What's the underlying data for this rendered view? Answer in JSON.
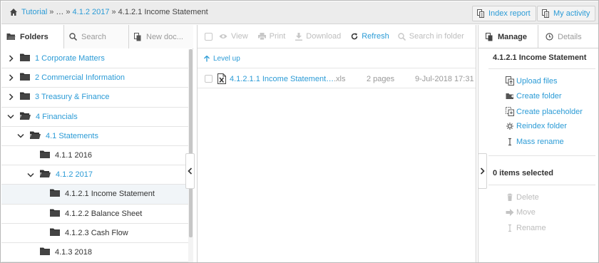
{
  "breadcrumb": {
    "items": [
      "Tutorial",
      "…",
      "4.1.2 2017"
    ],
    "separator": "»",
    "current": "4.1.2.1 Income Statement"
  },
  "header": {
    "index_report_label": "Index report",
    "my_activity_label": "My activity"
  },
  "left_tabs": {
    "folders_label": "Folders",
    "search_placeholder": "Search",
    "new_doc_label": "New doc..."
  },
  "tree": [
    {
      "label": "1 Corporate Matters",
      "state": "collapsed",
      "style": "link"
    },
    {
      "label": "2 Commercial Information",
      "state": "collapsed",
      "style": "link"
    },
    {
      "label": "3 Treasury & Finance",
      "state": "collapsed",
      "style": "link"
    },
    {
      "label": "4 Financials",
      "state": "expanded",
      "style": "link"
    },
    {
      "label": "4.1 Statements",
      "state": "expanded",
      "style": "link"
    },
    {
      "label": "4.1.1 2016",
      "state": "none",
      "style": "plain"
    },
    {
      "label": "4.1.2 2017",
      "state": "expanded",
      "style": "link"
    },
    {
      "label": "4.1.2.1 Income Statement",
      "state": "none",
      "style": "plain",
      "selected": true
    },
    {
      "label": "4.1.2.2 Balance Sheet",
      "state": "none",
      "style": "plain"
    },
    {
      "label": "4.1.2.3 Cash Flow",
      "state": "none",
      "style": "plain"
    },
    {
      "label": "4.1.3 2018",
      "state": "none",
      "style": "plain"
    }
  ],
  "toolbar": {
    "view_label": "View",
    "print_label": "Print",
    "download_label": "Download",
    "refresh_label": "Refresh",
    "search_placeholder": "Search in folder"
  },
  "content": {
    "level_up_label": "Level up",
    "files": [
      {
        "name": "4.1.2.1.1 Income Statement…",
        "ext": ".xls",
        "pages": "2 pages",
        "date": "9-Jul-2018 17:31",
        "icon": "excel-file-icon"
      }
    ]
  },
  "right_tabs": {
    "manage_label": "Manage",
    "details_label": "Details"
  },
  "manage": {
    "title": "4.1.2.1 Income Statement",
    "actions": [
      {
        "label": "Upload files",
        "icon": "upload-icon"
      },
      {
        "label": "Create folder",
        "icon": "create-folder-icon"
      },
      {
        "label": "Create placeholder",
        "icon": "placeholder-icon"
      },
      {
        "label": "Reindex folder",
        "icon": "reindex-icon"
      },
      {
        "label": "Mass rename",
        "icon": "rename-icon"
      }
    ],
    "selected_text": "0 items selected",
    "selection_actions": [
      {
        "label": "Delete",
        "icon": "trash-icon"
      },
      {
        "label": "Move",
        "icon": "move-icon"
      },
      {
        "label": "Rename",
        "icon": "rename-icon"
      }
    ]
  },
  "colors": {
    "link": "#2b9bd6",
    "disabled": "#bdbdbd",
    "header_bg": "#ececec",
    "selected_row": "#f1f5f8"
  }
}
